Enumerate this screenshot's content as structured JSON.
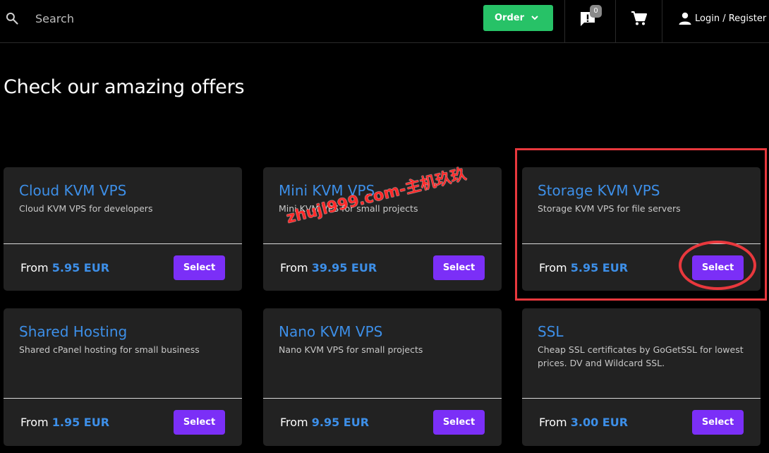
{
  "topbar": {
    "search_placeholder": "Search",
    "order_label": "Order",
    "notification_count": "0",
    "login_label": "Login / Register"
  },
  "main": {
    "heading": "Check our amazing offers"
  },
  "cards": [
    {
      "title": "Cloud KVM VPS",
      "description": "Cloud KVM VPS for developers",
      "price_prefix": "From ",
      "price": "5.95 EUR",
      "button": "Select"
    },
    {
      "title": "Mini KVM VPS",
      "description": "Mini KVM VPS for small projects",
      "price_prefix": "From ",
      "price": "39.95 EUR",
      "button": "Select"
    },
    {
      "title": "Storage KVM VPS",
      "description": "Storage KVM VPS for file servers",
      "price_prefix": "From ",
      "price": "5.95 EUR",
      "button": "Select"
    },
    {
      "title": "Shared Hosting",
      "description": "Shared cPanel hosting for small business",
      "price_prefix": "From ",
      "price": "1.95 EUR",
      "button": "Select"
    },
    {
      "title": "Nano KVM VPS",
      "description": "Nano KVM VPS for small projects",
      "price_prefix": "From ",
      "price": "9.95 EUR",
      "button": "Select"
    },
    {
      "title": "SSL",
      "description": "Cheap SSL certificates by GoGetSSL for lowest prices. DV and Wildcard SSL.",
      "price_prefix": "From ",
      "price": "3.00 EUR",
      "button": "Select"
    }
  ],
  "watermark": "zhujl999.com-主机玖玖",
  "colors": {
    "accent_blue": "#3d8fe8",
    "button_purple": "#7b2ff7",
    "order_green": "#27c267",
    "annotation_red": "#e8383d"
  },
  "icons": [
    "search-icon",
    "chevron-down-icon",
    "notification-icon",
    "cart-icon",
    "user-icon"
  ]
}
